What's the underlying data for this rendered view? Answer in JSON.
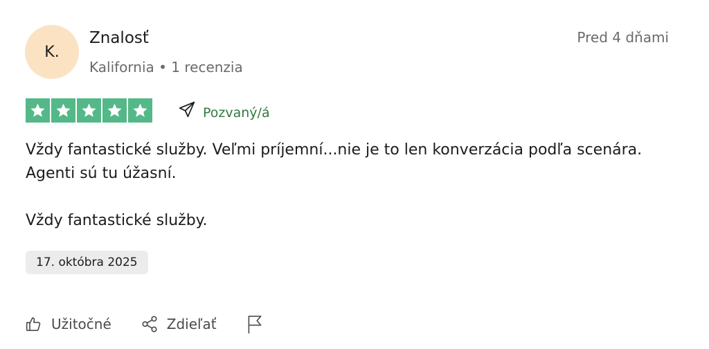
{
  "reviewer": {
    "initials": "K.",
    "name": "Znalosť",
    "meta": "Kalifornia • 1 recenzia",
    "posted": "Pred 4 dňami"
  },
  "rating": {
    "stars": 5,
    "max": 5,
    "color": "#54b888"
  },
  "invited": {
    "label": "Pozvaný/á",
    "icon": "send-icon",
    "color": "#2e7a3e"
  },
  "review": {
    "paragraph1": "Vždy fantastické služby. Veľmi príjemní...nie je to len konverzácia podľa scenára. Agenti sú tu úžasní.",
    "paragraph2": "Vždy fantastické služby.",
    "experience_date": "17. októbra 2025"
  },
  "actions": {
    "useful": {
      "label": "Užitočné",
      "icon": "thumbs-up-icon"
    },
    "share": {
      "label": "Zdieľať",
      "icon": "share-icon"
    },
    "report": {
      "icon": "flag-icon"
    }
  }
}
